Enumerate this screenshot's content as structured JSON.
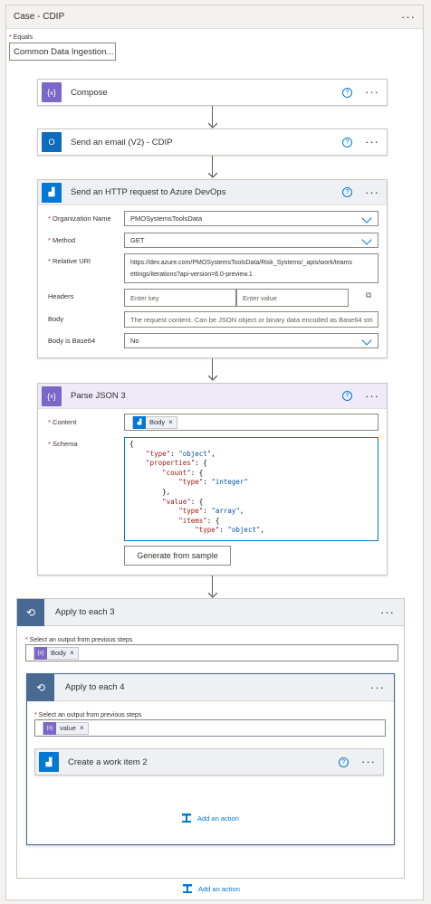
{
  "case": {
    "title": "Case - CDIP",
    "equals_label": "Equals",
    "equals_value": "Common Data Ingestion..."
  },
  "compose": {
    "title": "Compose"
  },
  "email": {
    "title": "Send an email (V2) - CDIP"
  },
  "http": {
    "title": "Send an HTTP request to Azure DevOps",
    "org_label": "Organization Name",
    "org_value": "PMOSystemsToolsData",
    "method_label": "Method",
    "method_value": "GET",
    "uri_label": "Relative URI",
    "uri_line1": "https://dev.azure.com/PMOSystemsToolsData/Risk_Systems/_apis/work/teams",
    "uri_line2": "ettings/iterations?api-version=6.0-preview.1",
    "headers_label": "Headers",
    "header_key_placeholder": "Enter key",
    "header_value_placeholder": "Enter value",
    "body_label": "Body",
    "body_placeholder": "The request content. Can be JSON object or binary data encoded as Base64 stri",
    "b64_label": "Body is Base64",
    "b64_value": "No"
  },
  "parse": {
    "title": "Parse JSON 3",
    "content_label": "Content",
    "content_token": "Body",
    "schema_label": "Schema",
    "generate_button": "Generate from sample"
  },
  "apply3": {
    "title": "Apply to each 3",
    "select_label": "Select an output from previous steps",
    "token": "Body"
  },
  "apply4": {
    "title": "Apply to each 4",
    "select_label": "Select an output from previous steps",
    "token": "value"
  },
  "workitem": {
    "title": "Create a work item 2"
  },
  "add_action_inner": "Add an action",
  "add_action_outer": "Add an action",
  "colors": {
    "purple": "#7b68c6",
    "blue": "#0f6cbd",
    "loop": "#486991",
    "link": "#0078d4"
  }
}
